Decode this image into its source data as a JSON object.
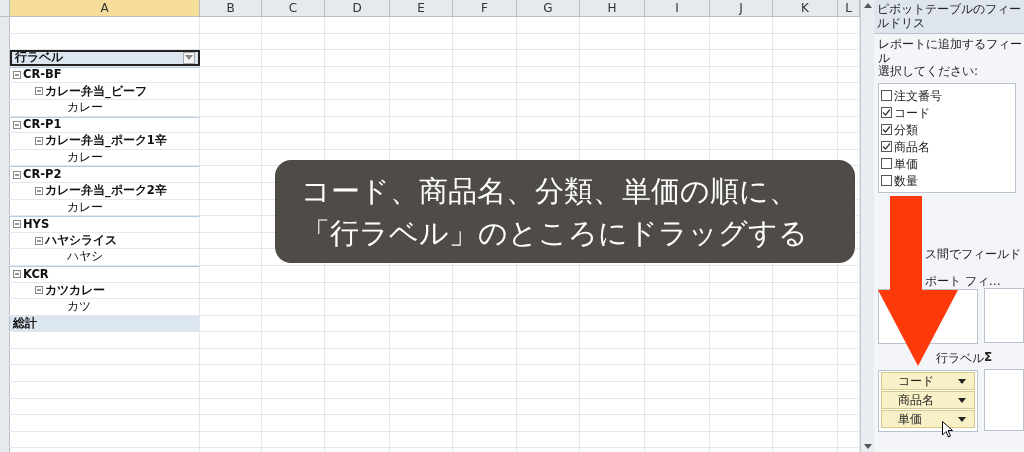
{
  "columns": [
    "A",
    "B",
    "C",
    "D",
    "E",
    "F",
    "G",
    "H",
    "I",
    "J",
    "K",
    "L"
  ],
  "pivot": {
    "header": "行ラベル",
    "rows": [
      {
        "label": "CR-BF",
        "expanded": true,
        "children": [
          {
            "label": "カレー弁当_ビーフ",
            "expanded": true,
            "children": [
              {
                "label": "カレー"
              }
            ]
          }
        ]
      },
      {
        "label": "CR-P1",
        "expanded": true,
        "children": [
          {
            "label": "カレー弁当_ポーク1辛",
            "expanded": true,
            "children": [
              {
                "label": "カレー"
              }
            ]
          }
        ]
      },
      {
        "label": "CR-P2",
        "expanded": true,
        "children": [
          {
            "label": "カレー弁当_ポーク2辛",
            "expanded": true,
            "children": [
              {
                "label": "カレー"
              }
            ]
          }
        ]
      },
      {
        "label": "HYS",
        "expanded": true,
        "children": [
          {
            "label": "ハヤシライス",
            "expanded": true,
            "children": [
              {
                "label": "ハヤシ"
              }
            ]
          }
        ]
      },
      {
        "label": "KCR",
        "expanded": true,
        "children": [
          {
            "label": "カツカレー",
            "expanded": true,
            "children": [
              {
                "label": "カツ"
              }
            ]
          }
        ]
      }
    ],
    "total": "総計"
  },
  "caption": [
    "コード、商品名、分類、単価の順に、",
    "「行ラベル」のところにドラッグする"
  ],
  "field_list": {
    "title": "ピボットテーブルのフィールドリス",
    "instruction": [
      "レポートに追加するフィール",
      "選択してください:"
    ],
    "fields": [
      {
        "label": "注文番号",
        "checked": false
      },
      {
        "label": "コード",
        "checked": true
      },
      {
        "label": "分類",
        "checked": true
      },
      {
        "label": "商品名",
        "checked": true
      },
      {
        "label": "単価",
        "checked": false
      },
      {
        "label": "数量",
        "checked": false
      }
    ],
    "drag_hint": "ス間でフィールド",
    "report_filter_label": "ポート フィ…",
    "row_labels_label": "行ラベル",
    "values_label": "Σ",
    "row_fields": [
      "コード",
      "商品名",
      "単価"
    ]
  }
}
